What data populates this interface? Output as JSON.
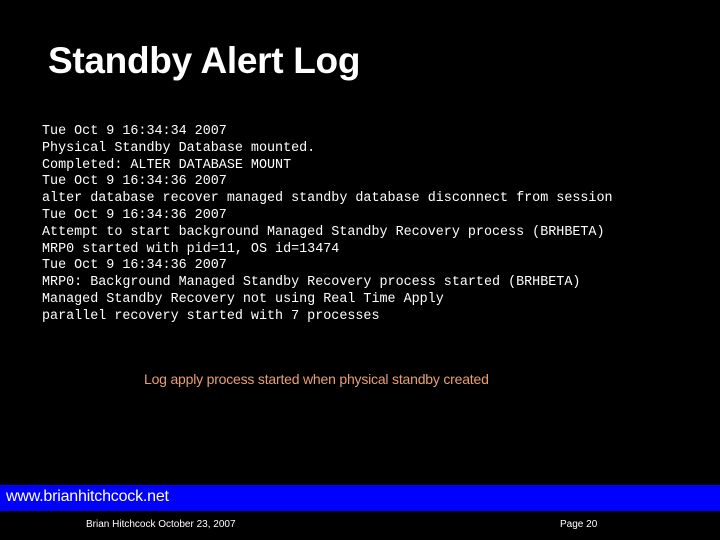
{
  "slide": {
    "title": "Standby Alert Log",
    "log_lines": [
      "Tue Oct 9 16:34:34 2007",
      "Physical Standby Database mounted.",
      "Completed: ALTER DATABASE MOUNT",
      "Tue Oct 9 16:34:36 2007",
      "alter database recover managed standby database disconnect from session",
      "Tue Oct 9 16:34:36 2007",
      "Attempt to start background Managed Standby Recovery process (BRHBETA)",
      "MRP0 started with pid=11, OS id=13474",
      "Tue Oct 9 16:34:36 2007",
      "MRP0: Background Managed Standby Recovery process started (BRHBETA)",
      "Managed Standby Recovery not using Real Time Apply",
      "parallel recovery started with 7 processes"
    ],
    "annotation": "Log apply process started when physical standby created"
  },
  "footer": {
    "url": "www.brianhitchcock.net",
    "author_date": "Brian Hitchcock  October 23, 2007",
    "page": "Page 20"
  },
  "colors": {
    "background": "#000000",
    "text": "#ffffff",
    "annotation": "#e8a070",
    "footer_bar": "#0000ff"
  }
}
